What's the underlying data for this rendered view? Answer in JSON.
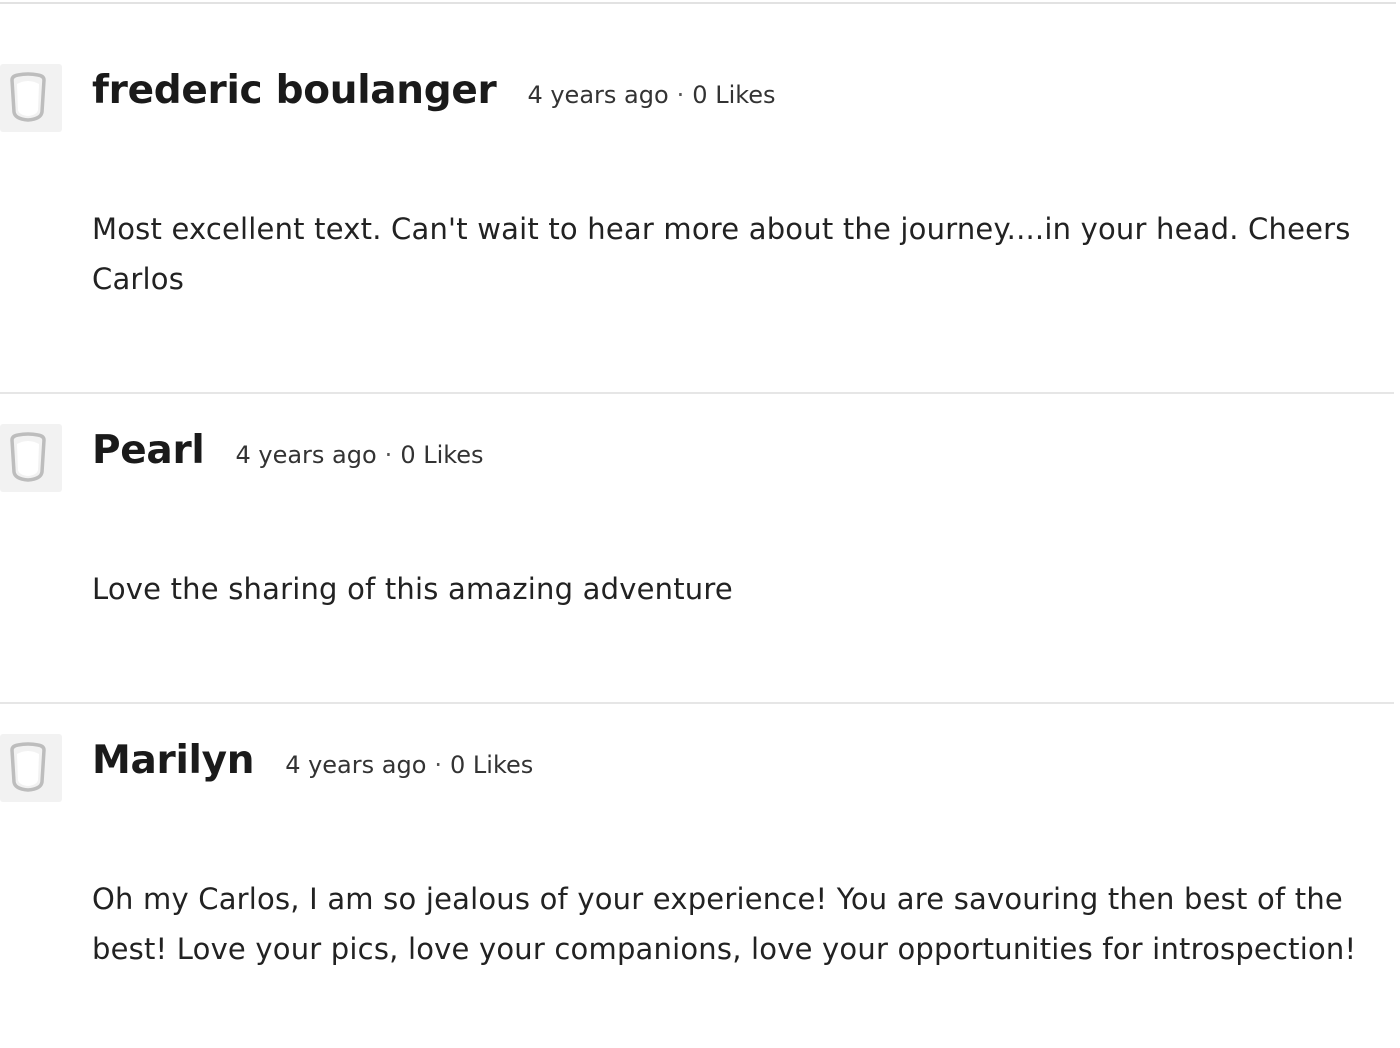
{
  "comments": [
    {
      "author": "frederic boulanger",
      "time": "4 years ago",
      "likes": "0 Likes",
      "text": "Most excellent text. Can't wait to hear more about the journey....in your head. Cheers Carlos"
    },
    {
      "author": "Pearl",
      "time": "4 years ago",
      "likes": "0 Likes",
      "text": "Love the sharing of this amazing adventure"
    },
    {
      "author": "Marilyn",
      "time": "4 years ago",
      "likes": "0 Likes",
      "text": "Oh my Carlos, I am so jealous of your experience! You are savouring then best of the best! Love your pics, love your companions, love your opportunities for introspection!"
    }
  ],
  "separator": "·",
  "avatar_icon": "default-user-avatar-icon"
}
